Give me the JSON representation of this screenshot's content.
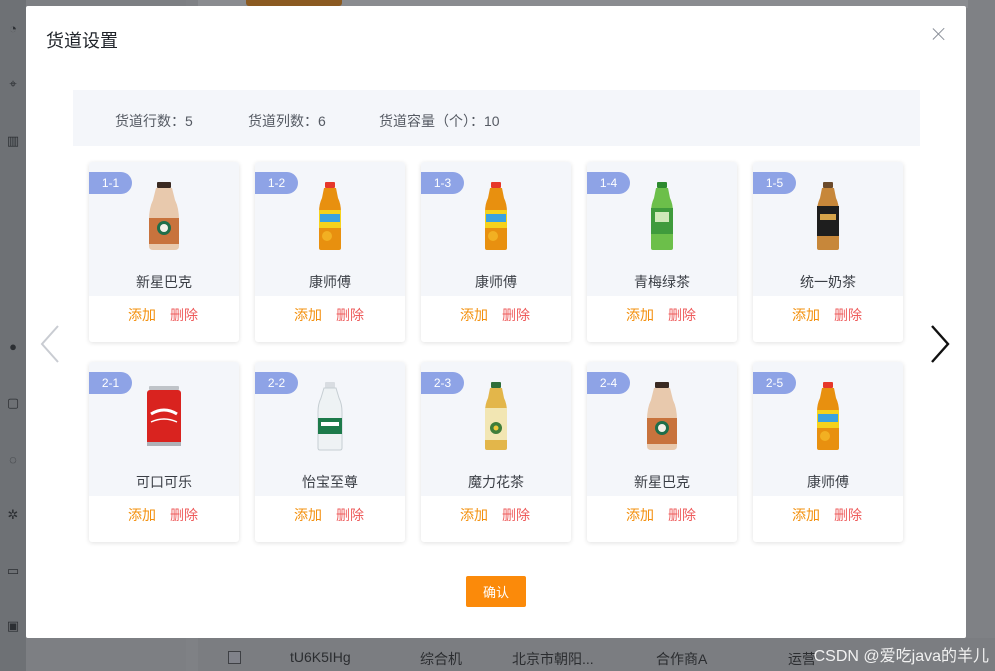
{
  "background": {
    "row": {
      "code": "tU6K5IHg",
      "type": "综合机",
      "address": "北京市朝阳...",
      "partner": "合作商A",
      "status": "运营"
    },
    "watermark": "CSDN @爱吃java的羊儿"
  },
  "modal": {
    "title": "货道设置",
    "info": {
      "rows": "货道行数：5",
      "cols": "货道列数：6",
      "capacity": "货道容量（个）：10"
    },
    "slots": [
      {
        "code": "1-1",
        "name": "新星巴克",
        "product": "starbucks"
      },
      {
        "code": "1-2",
        "name": "康师傅",
        "product": "iced-tea"
      },
      {
        "code": "1-3",
        "name": "康师傅",
        "product": "iced-tea"
      },
      {
        "code": "1-4",
        "name": "青梅绿茶",
        "product": "green-tea"
      },
      {
        "code": "1-5",
        "name": "统一奶茶",
        "product": "milk-tea"
      },
      {
        "code": "2-1",
        "name": "可口可乐",
        "product": "coke"
      },
      {
        "code": "2-2",
        "name": "怡宝至尊",
        "product": "water"
      },
      {
        "code": "2-3",
        "name": "魔力花茶",
        "product": "flower-tea"
      },
      {
        "code": "2-4",
        "name": "新星巴克",
        "product": "starbucks"
      },
      {
        "code": "2-5",
        "name": "康师傅",
        "product": "iced-tea"
      }
    ],
    "add_label": "添加",
    "delete_label": "删除",
    "confirm_label": "确认"
  },
  "colors": {
    "accent": "#fb8a0a",
    "badge": "#8ea3e6",
    "delete": "#ee5c5c",
    "panel": "#f4f6fa"
  }
}
